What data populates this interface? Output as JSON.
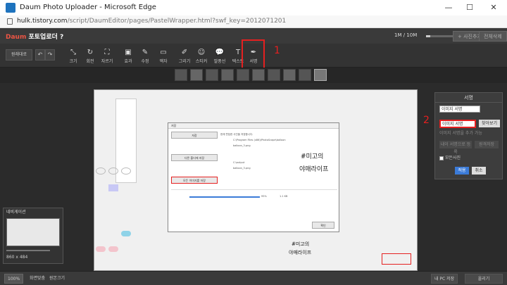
{
  "window": {
    "title": "Daum Photo Uploader - Microsoft Edge",
    "min": "—",
    "max": "☐",
    "close": "✕"
  },
  "address": {
    "domain": "hulk.tistory.com",
    "path": "/script/DaumEditor/pages/PastelWrapper.html?swf_key=2012071201"
  },
  "app": {
    "logo_brand": "Daum",
    "logo_text": "포토업로더 ?",
    "progress": "1M / 10M",
    "add_photo": "+ 사진추가",
    "delete_all": "전체삭제"
  },
  "toolbar": {
    "undo_all": "원래대로",
    "undo_arrow": "↶",
    "redo_arrow": "↷",
    "tools": [
      {
        "icon": "⤡",
        "label": "크기"
      },
      {
        "icon": "↻",
        "label": "회전"
      },
      {
        "icon": "⛶",
        "label": "자르기"
      },
      {
        "icon": "▣",
        "label": "효과"
      },
      {
        "icon": "✎",
        "label": "수정"
      },
      {
        "icon": "▭",
        "label": "액자"
      },
      {
        "icon": "✐",
        "label": "그리기"
      },
      {
        "icon": "☺",
        "label": "스티커"
      },
      {
        "icon": "💬",
        "label": "말풍선"
      },
      {
        "icon": "T",
        "label": "텍스트"
      },
      {
        "icon": "✒",
        "label": "서명"
      }
    ],
    "annotation_1": "1"
  },
  "canvas": {
    "dialog_title": "저장",
    "dialog_buttons": [
      "저장",
      "다른 폴더에 저장",
      "모든 이미지를 저장"
    ],
    "dialog_texts": [
      "현재 편집한 사진을 저장합니다.",
      "C:\\Program Files (x86)\\PhotoScape\\balloon",
      "balloon_3.png",
      "C:\\output",
      "balloon_3.png"
    ],
    "quality": "95%",
    "filesize": "1.1 KB",
    "ok": "확인",
    "handwriting_1": "#미고의",
    "handwriting_2": "야매라이프",
    "handwriting_small_1": "#미고의",
    "handwriting_small_2": "야매라이프"
  },
  "signature_panel": {
    "title": "서명",
    "select_value": "이미지 서명",
    "option_selected": "이미지 서명",
    "browse": "찾아보기",
    "hint": "이미지 서명을 추가 가능",
    "fileopen": "내이 서명으로 등록",
    "delete": "원격저장",
    "all_photos": "모든사진",
    "apply": "적용",
    "cancel": "취소",
    "annotation_2": "2"
  },
  "navigator": {
    "title": "네비게이션",
    "size": "860 x 484"
  },
  "bottom": {
    "zoom": "100%",
    "fit": "화면맞춤",
    "original": "원본크기",
    "pc_save": "내 PC 저장",
    "upload": "올리기"
  },
  "colors": {
    "annotation_red": "#e52020",
    "apply_blue": "#3b7bd8"
  }
}
